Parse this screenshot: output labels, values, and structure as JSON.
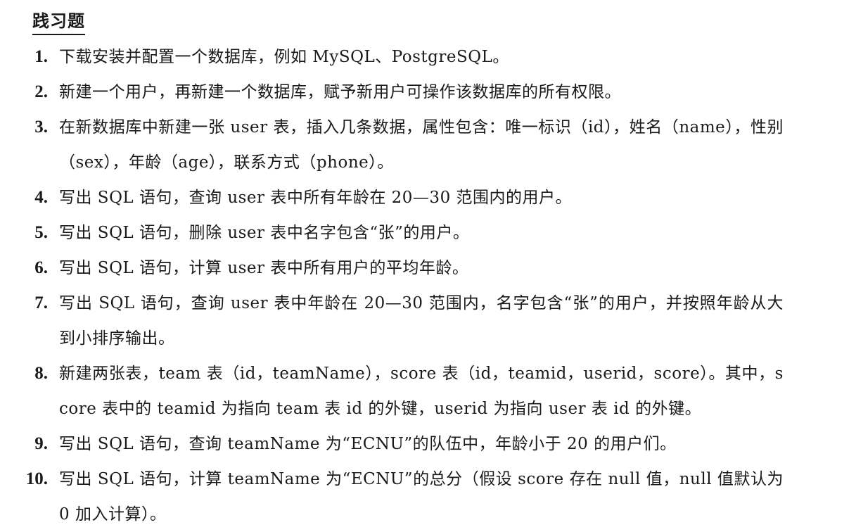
{
  "heading": "践习题",
  "exercises": [
    {
      "num": "1.",
      "text": "下载安装并配置一个数据库，例如 MySQL、PostgreSQL。"
    },
    {
      "num": "2.",
      "text": "新建一个用户，再新建一个数据库，赋予新用户可操作该数据库的所有权限。"
    },
    {
      "num": "3.",
      "text": "在新数据库中新建一张 user 表，插入几条数据，属性包含：唯一标识（id），姓名（name），性别（sex），年龄（age），联系方式（phone）。"
    },
    {
      "num": "4.",
      "text": "写出 SQL 语句，查询 user 表中所有年龄在 20—30 范围内的用户。"
    },
    {
      "num": "5.",
      "text": "写出 SQL 语句，删除 user 表中名字包含“张”的用户。"
    },
    {
      "num": "6.",
      "text": "写出 SQL 语句，计算 user 表中所有用户的平均年龄。"
    },
    {
      "num": "7.",
      "text": "写出 SQL 语句，查询 user 表中年龄在 20—30 范围内，名字包含“张”的用户，并按照年龄从大到小排序输出。"
    },
    {
      "num": "8.",
      "text": "新建两张表，team 表（id，teamName），score 表（id，teamid，userid，score）。其中，score 表中的 teamid 为指向 team 表 id 的外键，userid 为指向 user 表 id 的外键。"
    },
    {
      "num": "9.",
      "text": "写出 SQL 语句，查询 teamName 为“ECNU”的队伍中，年龄小于 20 的用户们。"
    },
    {
      "num": "10.",
      "text": "写出 SQL 语句，计算 teamName 为“ECNU”的总分（假设 score 存在 null 值，null 值默认为 0 加入计算）。"
    }
  ]
}
